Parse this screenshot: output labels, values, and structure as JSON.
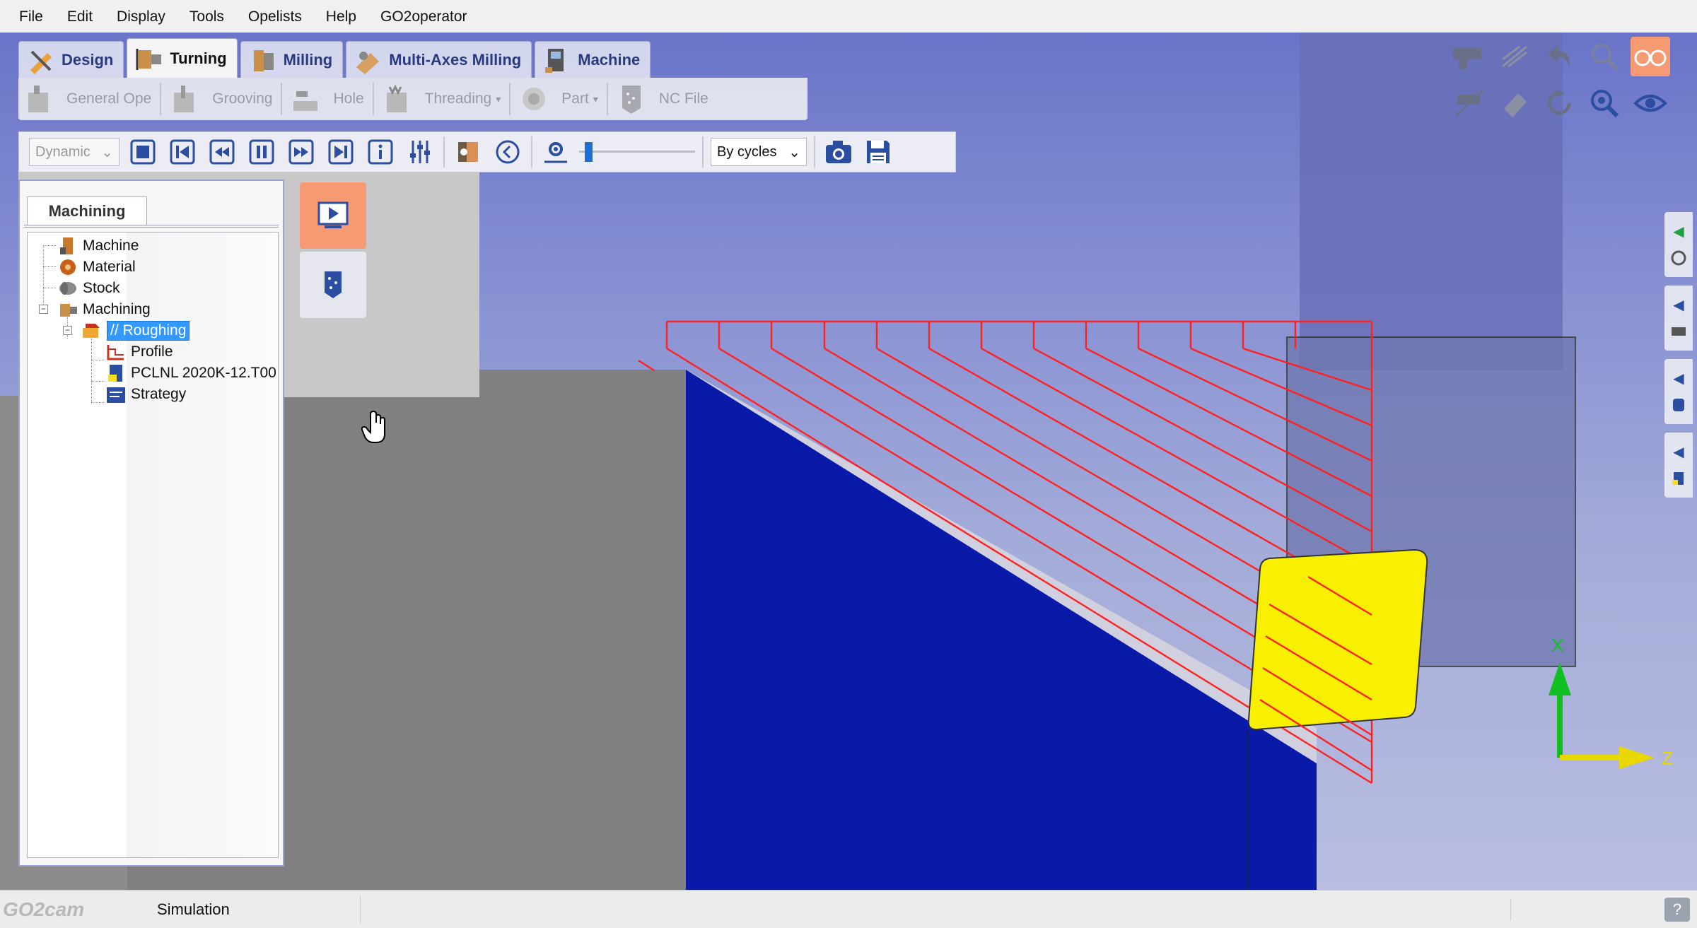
{
  "menu": [
    "File",
    "Edit",
    "Display",
    "Tools",
    "Opelists",
    "Help",
    "GO2operator"
  ],
  "ribbon": {
    "tabs": [
      {
        "label": "Design",
        "icon": "design-icon"
      },
      {
        "label": "Turning",
        "icon": "turning-icon",
        "active": true
      },
      {
        "label": "Milling",
        "icon": "milling-icon"
      },
      {
        "label": "Multi-Axes Milling",
        "icon": "multi-axes-milling-icon"
      },
      {
        "label": "Machine",
        "icon": "machine-icon"
      }
    ],
    "items": [
      {
        "label": "General Ope",
        "icon": "general-operation-icon"
      },
      {
        "label": "Grooving",
        "icon": "grooving-icon"
      },
      {
        "label": "Hole",
        "icon": "hole-icon"
      },
      {
        "label": "Threading",
        "icon": "threading-icon"
      },
      {
        "label": "Part",
        "icon": "part-icon"
      },
      {
        "label": "NC File",
        "icon": "nc-file-icon"
      }
    ]
  },
  "simulation_toolbar": {
    "display_mode": "Dynamic",
    "step_mode": "By cycles",
    "speed_level": 0.05
  },
  "tree_panel": {
    "tab_label": "Machining",
    "nodes": {
      "machine": "Machine",
      "material": "Material",
      "stock": "Stock",
      "machining": "Machining",
      "roughing": "// Roughing",
      "profile": "Profile",
      "tool": "PCLNL 2020K-12.T00",
      "strategy": "Strategy"
    }
  },
  "statusbar": {
    "logo": "GO2cam",
    "mode": "Simulation",
    "help": "?"
  },
  "axes": {
    "x_label": "X",
    "z_label": "Z"
  },
  "colors": {
    "toolpath": "#ff2020",
    "insert": "#f8f000",
    "part": "#0a1aa8",
    "stock": "#808080",
    "axis_x": "#10c020",
    "axis_z": "#e8d800",
    "active_side_button": "#f59a72"
  }
}
